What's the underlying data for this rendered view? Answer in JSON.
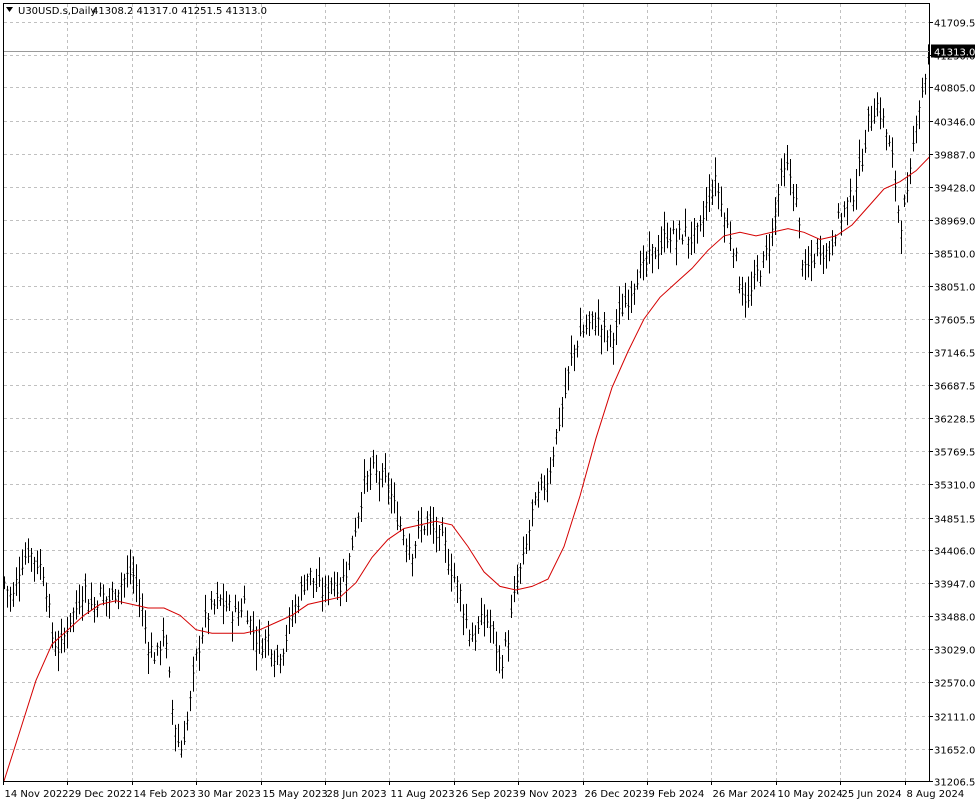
{
  "header": {
    "symbol": "U30USD.s,Daily",
    "ohlc": "41308.2 41317.0 41251.5 41313.0"
  },
  "colors": {
    "bars": "#000000",
    "ma_line": "#d40000",
    "grid": "#c0c0c0",
    "price_tag_bg": "#000000",
    "price_tag_text": "#ffffff",
    "background": "#ffffff"
  },
  "chart_data": {
    "type": "line",
    "title": "",
    "grid": true,
    "y_ticks": [
      41709.5,
      41250.0,
      40805.0,
      40346.0,
      39887.0,
      39428.0,
      38969.0,
      38510.0,
      38051.0,
      37605.5,
      37146.5,
      36687.5,
      36228.5,
      35769.5,
      35310.0,
      34851.5,
      34406.0,
      33947.0,
      33488.0,
      33029.0,
      32570.0,
      32111.0,
      31652.0,
      31206.5
    ],
    "y_tick_labels": [
      "41709.5",
      "41250.0",
      "40805.0",
      "40346.0",
      "39887.0",
      "39428.0",
      "38969.0",
      "38510.0",
      "38051.0",
      "37605.5",
      "37146.5",
      "36687.5",
      "36228.5",
      "35769.5",
      "35310.0",
      "34851.5",
      "34406.0",
      "33947.0",
      "33488.0",
      "33029.0",
      "32570.0",
      "32111.0",
      "31652.0",
      "31206.5"
    ],
    "ylim": [
      31206.5,
      41709.5
    ],
    "x_labels": [
      "14 Nov 2022",
      "29 Dec 2022",
      "14 Feb 2023",
      "30 Mar 2023",
      "15 May 2023",
      "28 Jun 2023",
      "11 Aug 2023",
      "26 Sep 2023",
      "9 Nov 2023",
      "26 Dec 2023",
      "9 Feb 2024",
      "26 Mar 2024",
      "10 May 2024",
      "25 Jun 2024",
      "8 Aug 2024"
    ],
    "current_price": "41313.0",
    "current_price_value": 41313.0,
    "series": [
      {
        "type": "ohlc",
        "points": [
          [
            0,
            33960
          ],
          [
            8,
            33700
          ],
          [
            16,
            34200
          ],
          [
            24,
            34400
          ],
          [
            32,
            34250
          ],
          [
            40,
            34100
          ],
          [
            48,
            33200
          ],
          [
            56,
            33000
          ],
          [
            64,
            33400
          ],
          [
            72,
            33600
          ],
          [
            80,
            33900
          ],
          [
            88,
            33600
          ],
          [
            96,
            33800
          ],
          [
            104,
            33700
          ],
          [
            112,
            33850
          ],
          [
            120,
            34000
          ],
          [
            128,
            34100
          ],
          [
            136,
            33700
          ],
          [
            144,
            33100
          ],
          [
            152,
            32900
          ],
          [
            160,
            33300
          ],
          [
            168,
            32200
          ],
          [
            176,
            31600
          ],
          [
            184,
            32100
          ],
          [
            192,
            32900
          ],
          [
            200,
            33400
          ],
          [
            208,
            33600
          ],
          [
            216,
            33700
          ],
          [
            224,
            33600
          ],
          [
            232,
            33500
          ],
          [
            240,
            33700
          ],
          [
            248,
            33300
          ],
          [
            256,
            33100
          ],
          [
            264,
            33200
          ],
          [
            272,
            32900
          ],
          [
            280,
            33100
          ],
          [
            288,
            33500
          ],
          [
            296,
            33800
          ],
          [
            304,
            34100
          ],
          [
            312,
            33900
          ],
          [
            320,
            33800
          ],
          [
            328,
            34000
          ],
          [
            336,
            33900
          ],
          [
            344,
            34200
          ],
          [
            352,
            34800
          ],
          [
            360,
            35300
          ],
          [
            368,
            35500
          ],
          [
            376,
            35400
          ],
          [
            384,
            35300
          ],
          [
            392,
            34900
          ],
          [
            400,
            34600
          ],
          [
            408,
            34400
          ],
          [
            416,
            34700
          ],
          [
            424,
            34800
          ],
          [
            432,
            34600
          ],
          [
            440,
            34500
          ],
          [
            448,
            34100
          ],
          [
            456,
            33800
          ],
          [
            464,
            33300
          ],
          [
            472,
            33200
          ],
          [
            480,
            33500
          ],
          [
            488,
            33300
          ],
          [
            496,
            32800
          ],
          [
            504,
            33200
          ],
          [
            512,
            33900
          ],
          [
            520,
            34300
          ],
          [
            528,
            34900
          ],
          [
            536,
            35200
          ],
          [
            544,
            35400
          ],
          [
            552,
            36000
          ],
          [
            560,
            36500
          ],
          [
            568,
            37100
          ],
          [
            576,
            37400
          ],
          [
            584,
            37500
          ],
          [
            592,
            37600
          ],
          [
            600,
            37400
          ],
          [
            608,
            37300
          ],
          [
            616,
            37700
          ],
          [
            624,
            37900
          ],
          [
            632,
            38200
          ],
          [
            640,
            38300
          ],
          [
            648,
            38500
          ],
          [
            656,
            38600
          ],
          [
            664,
            38800
          ],
          [
            672,
            38700
          ],
          [
            680,
            38800
          ],
          [
            688,
            38700
          ],
          [
            696,
            38800
          ],
          [
            704,
            39300
          ],
          [
            712,
            39500
          ],
          [
            720,
            39000
          ],
          [
            728,
            38700
          ],
          [
            736,
            38100
          ],
          [
            744,
            37800
          ],
          [
            752,
            38200
          ],
          [
            760,
            38400
          ],
          [
            768,
            38800
          ],
          [
            776,
            39500
          ],
          [
            784,
            39700
          ],
          [
            792,
            39200
          ],
          [
            800,
            38200
          ],
          [
            808,
            38400
          ],
          [
            816,
            38600
          ],
          [
            824,
            38500
          ],
          [
            832,
            38900
          ],
          [
            840,
            39100
          ],
          [
            848,
            39300
          ],
          [
            856,
            39700
          ],
          [
            864,
            40300
          ],
          [
            872,
            40600
          ],
          [
            880,
            40300
          ],
          [
            888,
            39800
          ],
          [
            896,
            38900
          ],
          [
            904,
            39300
          ],
          [
            912,
            40400
          ],
          [
            920,
            40900
          ],
          [
            926,
            41313
          ]
        ]
      },
      {
        "name": "",
        "type": "line",
        "points": [
          [
            0,
            31206.5
          ],
          [
            16,
            31900
          ],
          [
            32,
            32600
          ],
          [
            48,
            33100
          ],
          [
            64,
            33300
          ],
          [
            80,
            33500
          ],
          [
            96,
            33650
          ],
          [
            112,
            33700
          ],
          [
            128,
            33650
          ],
          [
            144,
            33600
          ],
          [
            160,
            33600
          ],
          [
            176,
            33500
          ],
          [
            192,
            33300
          ],
          [
            208,
            33250
          ],
          [
            224,
            33250
          ],
          [
            240,
            33250
          ],
          [
            256,
            33300
          ],
          [
            272,
            33400
          ],
          [
            288,
            33500
          ],
          [
            304,
            33650
          ],
          [
            320,
            33700
          ],
          [
            336,
            33750
          ],
          [
            352,
            33950
          ],
          [
            368,
            34300
          ],
          [
            384,
            34550
          ],
          [
            400,
            34700
          ],
          [
            416,
            34750
          ],
          [
            432,
            34800
          ],
          [
            448,
            34750
          ],
          [
            464,
            34450
          ],
          [
            480,
            34100
          ],
          [
            496,
            33900
          ],
          [
            512,
            33850
          ],
          [
            528,
            33900
          ],
          [
            544,
            34000
          ],
          [
            560,
            34450
          ],
          [
            576,
            35150
          ],
          [
            592,
            35950
          ],
          [
            608,
            36650
          ],
          [
            624,
            37150
          ],
          [
            640,
            37600
          ],
          [
            656,
            37900
          ],
          [
            672,
            38100
          ],
          [
            688,
            38300
          ],
          [
            704,
            38550
          ],
          [
            720,
            38750
          ],
          [
            736,
            38800
          ],
          [
            752,
            38750
          ],
          [
            768,
            38800
          ],
          [
            784,
            38850
          ],
          [
            800,
            38800
          ],
          [
            816,
            38700
          ],
          [
            832,
            38750
          ],
          [
            848,
            38900
          ],
          [
            864,
            39150
          ],
          [
            880,
            39400
          ],
          [
            896,
            39500
          ],
          [
            912,
            39650
          ],
          [
            926,
            39850
          ]
        ]
      }
    ]
  }
}
